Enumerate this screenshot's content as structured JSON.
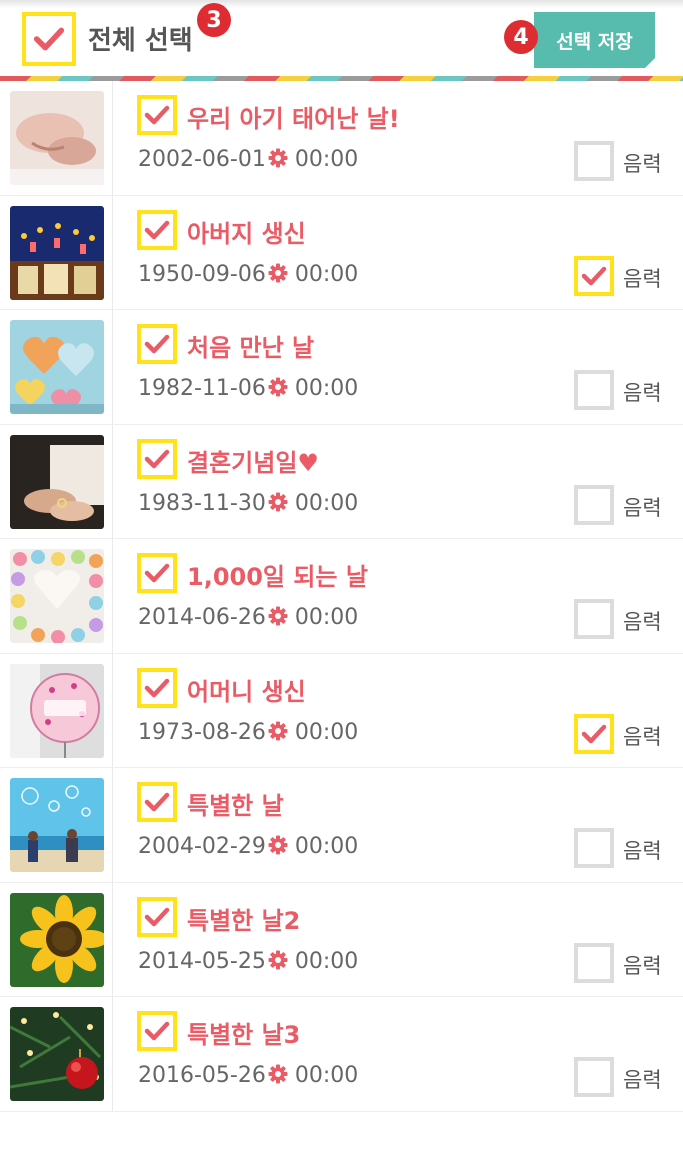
{
  "header": {
    "select_all_label": "전체 선택",
    "select_all_checked": true,
    "badge_select_all": "3",
    "badge_save": "4",
    "save_label": "선택 저장"
  },
  "colors": {
    "accent_red": "#ea5b66",
    "check_border": "#ffe21a",
    "save_button": "#57bbad",
    "badge": "#dd2d32"
  },
  "items": [
    {
      "title": "우리 아기 태어난 날!",
      "date": "2002-06-01",
      "time": "00:00",
      "checked": true,
      "lunar_label": "음력",
      "lunar_checked": false,
      "thumb": "baby-hands-photo"
    },
    {
      "title": "아버지 생신",
      "date": "1950-09-06",
      "time": "00:00",
      "checked": true,
      "lunar_label": "음력",
      "lunar_checked": true,
      "thumb": "birthday-cake-photo"
    },
    {
      "title": "처음 만난 날",
      "date": "1982-11-06",
      "time": "00:00",
      "checked": true,
      "lunar_label": "음력",
      "lunar_checked": false,
      "thumb": "candy-hearts-photo"
    },
    {
      "title": "결혼기념일♥",
      "date": "1983-11-30",
      "time": "00:00",
      "checked": true,
      "lunar_label": "음력",
      "lunar_checked": false,
      "thumb": "wedding-hands-photo"
    },
    {
      "title": "1,000일 되는 날",
      "date": "2014-06-26",
      "time": "00:00",
      "checked": true,
      "lunar_label": "음력",
      "lunar_checked": false,
      "thumb": "heart-candies-photo"
    },
    {
      "title": "어머니 생신",
      "date": "1973-08-26",
      "time": "00:00",
      "checked": true,
      "lunar_label": "음력",
      "lunar_checked": true,
      "thumb": "birthday-balloon-photo"
    },
    {
      "title": "특별한 날",
      "date": "2004-02-29",
      "time": "00:00",
      "checked": true,
      "lunar_label": "음력",
      "lunar_checked": false,
      "thumb": "beach-bubbles-photo"
    },
    {
      "title": "특별한 날2",
      "date": "2014-05-25",
      "time": "00:00",
      "checked": true,
      "lunar_label": "음력",
      "lunar_checked": false,
      "thumb": "sunflower-photo"
    },
    {
      "title": "특별한 날3",
      "date": "2016-05-26",
      "time": "00:00",
      "checked": true,
      "lunar_label": "음력",
      "lunar_checked": false,
      "thumb": "christmas-ornament-photo"
    }
  ]
}
